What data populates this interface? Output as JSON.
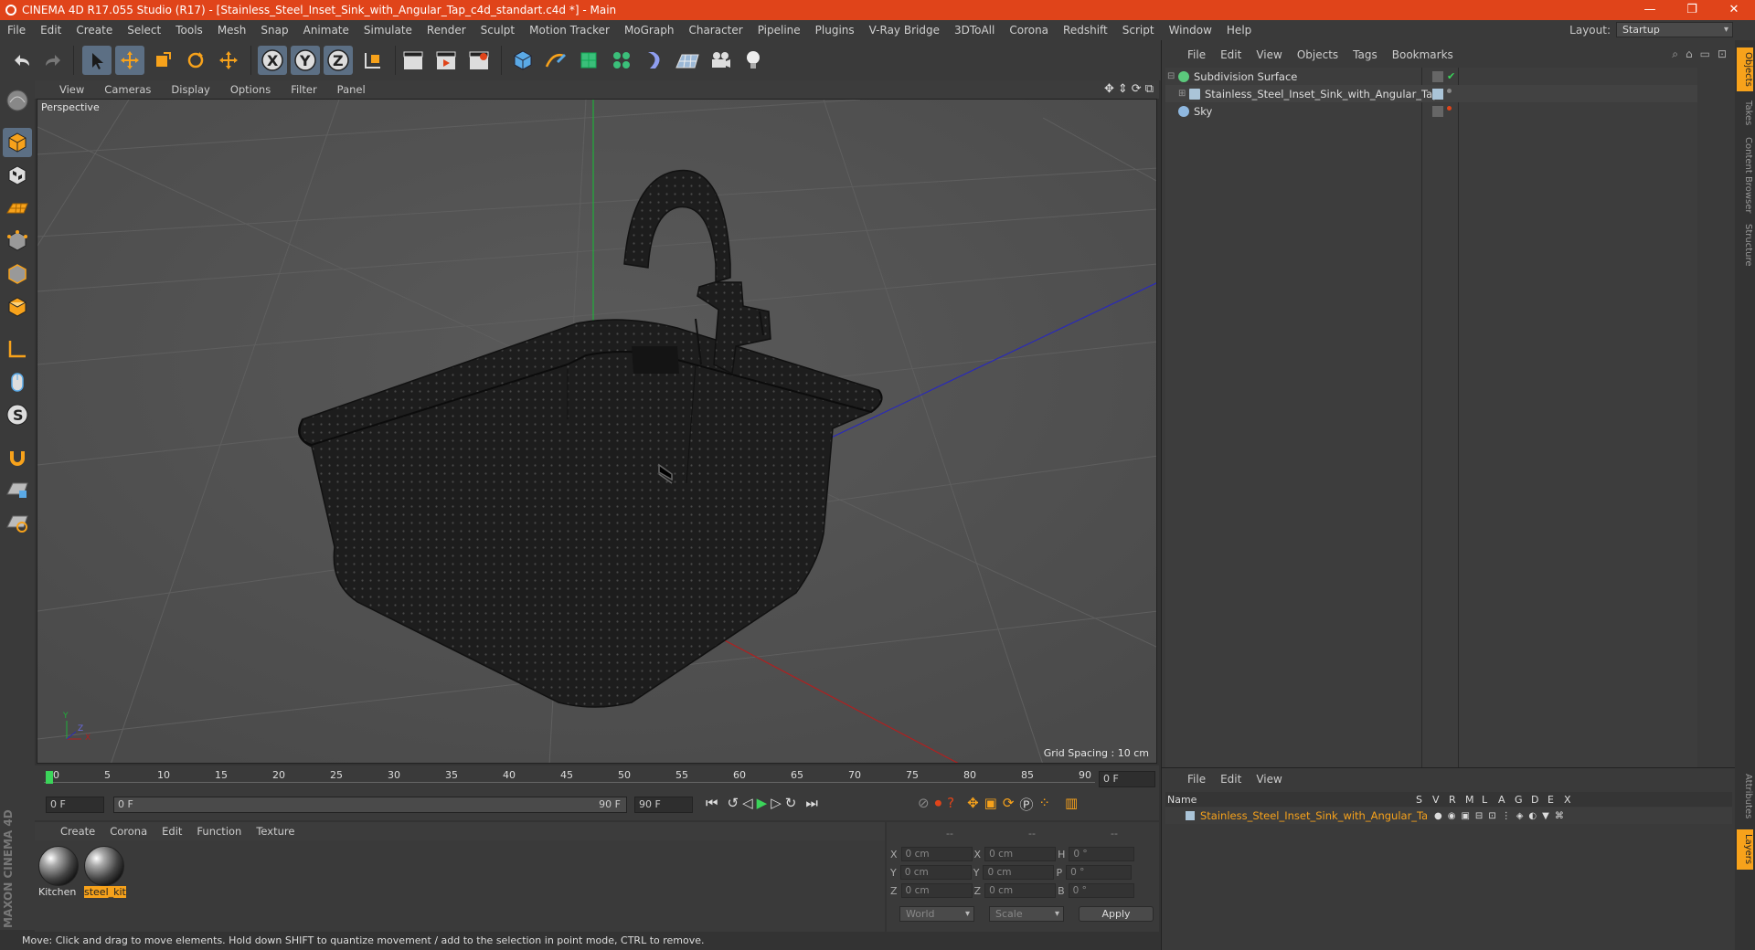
{
  "window": {
    "title": "CINEMA 4D R17.055 Studio (R17) - [Stainless_Steel_Inset_Sink_with_Angular_Tap_c4d_standart.c4d *] - Main",
    "controls": [
      "—",
      "❐",
      "✕"
    ]
  },
  "menubar": {
    "items": [
      "File",
      "Edit",
      "Create",
      "Select",
      "Tools",
      "Mesh",
      "Snap",
      "Animate",
      "Simulate",
      "Render",
      "Sculpt",
      "Motion Tracker",
      "MoGraph",
      "Character",
      "Pipeline",
      "Plugins",
      "V-Ray Bridge",
      "3DToAll",
      "Corona",
      "Redshift",
      "Script",
      "Window",
      "Help"
    ],
    "layout_label": "Layout:",
    "layout_value": "Startup"
  },
  "viewport": {
    "menu": [
      "View",
      "Cameras",
      "Display",
      "Options",
      "Filter",
      "Panel"
    ],
    "label": "Perspective",
    "grid_spacing": "Grid Spacing : 10 cm",
    "axis_x": "X",
    "axis_y": "Y",
    "axis_z": "Z"
  },
  "timeline": {
    "ticks": [
      "0",
      "5",
      "10",
      "15",
      "20",
      "25",
      "30",
      "35",
      "40",
      "45",
      "50",
      "55",
      "60",
      "65",
      "70",
      "75",
      "80",
      "85",
      "90"
    ],
    "current_frame": "0 F",
    "start_frame": "0 F",
    "range_start": "0 F",
    "range_end": "90 F",
    "end_frame": "90 F"
  },
  "materials": {
    "menu": [
      "Create",
      "Corona",
      "Edit",
      "Function",
      "Texture"
    ],
    "items": [
      {
        "label": "Kitchen",
        "selected": false
      },
      {
        "label": "steel_kit",
        "selected": true
      }
    ]
  },
  "coordinates": {
    "headers": [
      "--",
      "--",
      "--"
    ],
    "rows": [
      {
        "a": "X",
        "av": "0 cm",
        "b": "X",
        "bv": "0 cm",
        "c": "H",
        "cv": "0 °"
      },
      {
        "a": "Y",
        "av": "0 cm",
        "b": "Y",
        "bv": "0 cm",
        "c": "P",
        "cv": "0 °"
      },
      {
        "a": "Z",
        "av": "0 cm",
        "b": "Z",
        "bv": "0 cm",
        "c": "B",
        "cv": "0 °"
      }
    ],
    "space": "World",
    "mode": "Scale",
    "apply": "Apply"
  },
  "statusbar": {
    "text": "Move: Click and drag to move elements. Hold down SHIFT to quantize movement / add to the selection in point mode, CTRL to remove."
  },
  "object_manager": {
    "menu": [
      "File",
      "Edit",
      "View",
      "Objects",
      "Tags",
      "Bookmarks"
    ],
    "objects": [
      {
        "name": "Subdivision Surface",
        "color": "#5bc97c"
      },
      {
        "name": "Stainless_Steel_Inset_Sink_with_Angular_Tap",
        "color": "#aac4d8"
      },
      {
        "name": "Sky",
        "color": "#8fb8e0"
      }
    ]
  },
  "layer_manager": {
    "menu": [
      "File",
      "Edit",
      "View"
    ],
    "columns": [
      "Name",
      "S",
      "V",
      "R",
      "M",
      "L",
      "A",
      "G",
      "D",
      "E",
      "X"
    ],
    "layer_name": "Stainless_Steel_Inset_Sink_with_Angular_Tap"
  },
  "side_tabs": [
    "Objects",
    "Takes",
    "Content Browser",
    "Structure"
  ],
  "side_tabs_lower": [
    "Attributes",
    "Layers"
  ],
  "brand": "MAXON CINEMA 4D"
}
